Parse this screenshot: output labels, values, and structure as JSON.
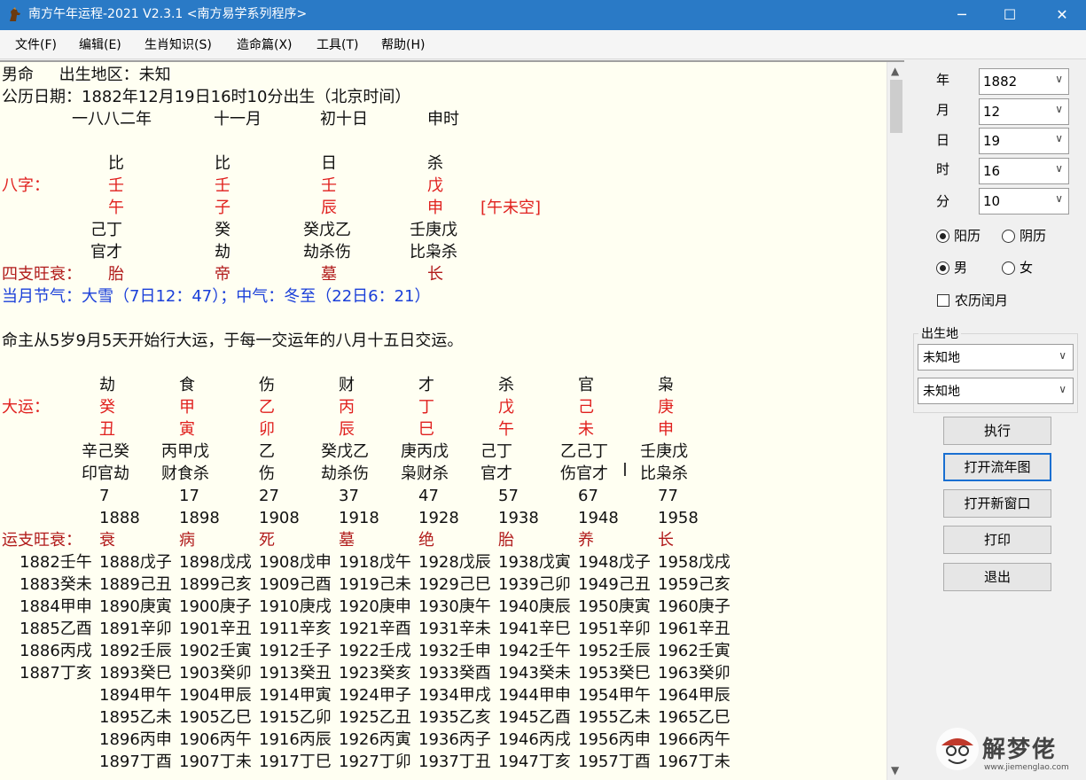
{
  "window": {
    "title": "南方午年运程-2021  V2.3.1  <南方易学系列程序>",
    "controls": {
      "minimize": "─",
      "maximize": "☐",
      "close": "✕"
    }
  },
  "menu": [
    "文件(F)",
    "编辑(E)",
    "生肖知识(S)",
    "造命篇(X)",
    "工具(T)",
    "帮助(H)"
  ],
  "chart": {
    "header": {
      "gender_line": "男命     出生地区：未知",
      "solar_date": "公历日期：1882年12月19日16时10分出生（北京时间）",
      "lunar": [
        "一八八二年",
        "十一月",
        "初十日",
        "申时"
      ]
    },
    "pillars": {
      "gods": [
        "比",
        "比",
        "日",
        "杀"
      ],
      "label_bazi": "八字：",
      "stems": [
        "壬",
        "壬",
        "壬",
        "戊"
      ],
      "branches": [
        "午",
        "子",
        "辰",
        "申"
      ],
      "void": "[午未空]",
      "hidden_stems": [
        "己丁",
        "癸",
        "癸戊乙",
        "壬庚戊"
      ],
      "hidden_gods": [
        "官才",
        "劫",
        "劫杀伤",
        "比枭杀"
      ],
      "label_wangshuai": "四支旺衰：",
      "wangshuai": [
        "胎",
        "帝",
        "墓",
        "长"
      ]
    },
    "solar_terms": "当月节气：大雪（7日12：47）；中气：冬至（22日6：21）",
    "dayun_start": "命主从5岁9月5天开始行大运，于每一交运年的八月十五日交运。",
    "dayun": {
      "label": "大运：",
      "gods": [
        "劫",
        "食",
        "伤",
        "财",
        "才",
        "杀",
        "官",
        "枭"
      ],
      "stems": [
        "癸",
        "甲",
        "乙",
        "丙",
        "丁",
        "戊",
        "己",
        "庚"
      ],
      "branches": [
        "丑",
        "寅",
        "卯",
        "辰",
        "巳",
        "午",
        "未",
        "申"
      ],
      "hidden_stems": [
        "辛己癸",
        "丙甲戊",
        "乙",
        "癸戊乙",
        "庚丙戊",
        "己丁",
        "乙己丁",
        "壬庚戊"
      ],
      "hidden_gods": [
        "印官劫",
        "财食杀",
        "伤",
        "劫杀伤",
        "枭财杀",
        "官才",
        "伤官才",
        "比枭杀"
      ],
      "ages": [
        "7",
        "17",
        "27",
        "37",
        "47",
        "57",
        "67",
        "77"
      ],
      "years": [
        "1888",
        "1898",
        "1908",
        "1918",
        "1928",
        "1938",
        "1948",
        "1958"
      ],
      "label_wangshuai": "运支旺衰：",
      "wangshuai": [
        "衰",
        "病",
        "死",
        "墓",
        "绝",
        "胎",
        "养",
        "长"
      ]
    },
    "liunian_pre": [
      "1882壬午",
      "1883癸未",
      "1884甲申",
      "1885乙酉",
      "1886丙戌",
      "1887丁亥"
    ],
    "liunian": [
      [
        "1888戊子",
        "1889己丑",
        "1890庚寅",
        "1891辛卯",
        "1892壬辰",
        "1893癸巳",
        "1894甲午",
        "1895乙未",
        "1896丙申",
        "1897丁酉"
      ],
      [
        "1898戊戌",
        "1899己亥",
        "1900庚子",
        "1901辛丑",
        "1902壬寅",
        "1903癸卯",
        "1904甲辰",
        "1905乙巳",
        "1906丙午",
        "1907丁未"
      ],
      [
        "1908戊申",
        "1909己酉",
        "1910庚戌",
        "1911辛亥",
        "1912壬子",
        "1913癸丑",
        "1914甲寅",
        "1915乙卯",
        "1916丙辰",
        "1917丁巳"
      ],
      [
        "1918戊午",
        "1919己未",
        "1920庚申",
        "1921辛酉",
        "1922壬戌",
        "1923癸亥",
        "1924甲子",
        "1925乙丑",
        "1926丙寅",
        "1927丁卯"
      ],
      [
        "1928戊辰",
        "1929己巳",
        "1930庚午",
        "1931辛未",
        "1932壬申",
        "1933癸酉",
        "1934甲戌",
        "1935乙亥",
        "1936丙子",
        "1937丁丑"
      ],
      [
        "1938戊寅",
        "1939己卯",
        "1940庚辰",
        "1941辛巳",
        "1942壬午",
        "1943癸未",
        "1944甲申",
        "1945乙酉",
        "1946丙戌",
        "1947丁亥"
      ],
      [
        "1948戊子",
        "1949己丑",
        "1950庚寅",
        "1951辛卯",
        "1952壬辰",
        "1953癸巳",
        "1954甲午",
        "1955乙未",
        "1956丙申",
        "1957丁酉"
      ],
      [
        "1958戊戌",
        "1959己亥",
        "1960庚子",
        "1961辛丑",
        "1962壬寅",
        "1963癸卯",
        "1964甲辰",
        "1965乙巳",
        "1966丙午",
        "1967丁未"
      ]
    ]
  },
  "panel": {
    "fields": [
      {
        "label": "年",
        "value": "1882"
      },
      {
        "label": "月",
        "value": "12"
      },
      {
        "label": "日",
        "value": "19"
      },
      {
        "label": "时",
        "value": "16"
      },
      {
        "label": "分",
        "value": "10"
      }
    ],
    "calendar": {
      "solar": "阳历",
      "lunar": "阴历",
      "selected": "solar"
    },
    "gender": {
      "male": "男",
      "female": "女",
      "selected": "male"
    },
    "leap_month": {
      "label": "农历闰月",
      "checked": false
    },
    "birthplace": {
      "title": "出生地",
      "province": "未知地",
      "city": "未知地"
    },
    "buttons": {
      "execute": "执行",
      "open_chart": "打开流年图",
      "new_window": "打开新窗口",
      "print": "打印",
      "exit": "退出"
    }
  },
  "watermark": {
    "text": "解梦佬",
    "url": "www.jiemenglao.com"
  },
  "colors": {
    "titlebar": "#2a7ac6",
    "red": "#e0201e",
    "dark_red": "#b11b1b",
    "blue": "#1a3fd9",
    "pane_bg": "#fffff2"
  }
}
